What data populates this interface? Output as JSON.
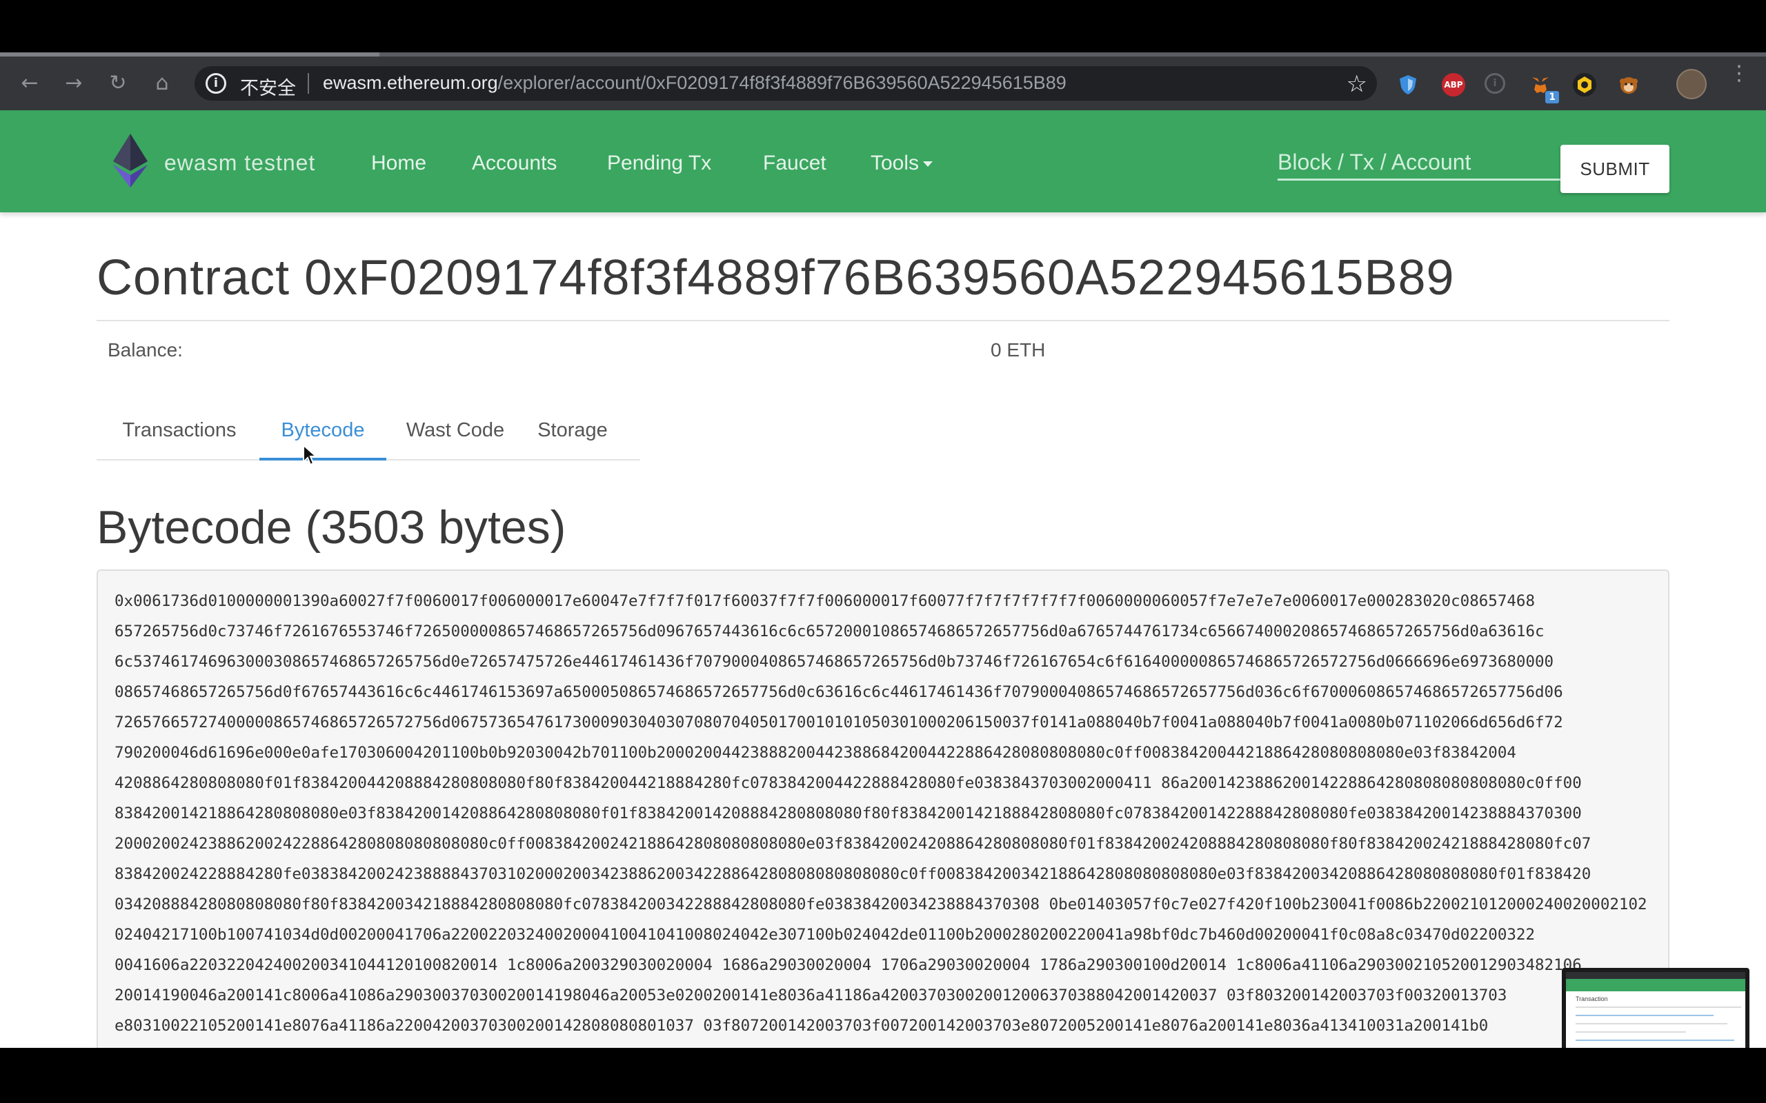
{
  "browser": {
    "nav": {
      "back": "←",
      "forward": "→",
      "reload": "↻",
      "home": "⌂"
    },
    "omnibox": {
      "security_label": "不安全",
      "url_host": "ewasm.ethereum.org",
      "url_path": "/explorer/account/0xF0209174f8f3f4889f76B639560A522945615B89"
    },
    "extensions": [
      {
        "icon": "shield-icon",
        "color": "#3c8ee0"
      },
      {
        "icon": "abp-icon",
        "label": "ABP",
        "color": "#c8272f"
      },
      {
        "icon": "info-circle-icon",
        "color": "#5f6368"
      },
      {
        "icon": "metamask-fox-icon",
        "badge": "1",
        "color": "#e2761b"
      },
      {
        "icon": "hexagon-icon",
        "color": "#202124"
      },
      {
        "icon": "monkey-icon",
        "color": "#b5651d"
      }
    ]
  },
  "site": {
    "brand": "ewasm testnet",
    "nav": [
      "Home",
      "Accounts",
      "Pending Tx",
      "Faucet",
      "Tools"
    ],
    "search_placeholder": "Block / Tx / Account",
    "submit_label": "SUBMIT",
    "accent": "#3aa660"
  },
  "contract": {
    "title": "Contract 0xF0209174f8f3f4889f76B639560A522945615B89",
    "balance_label": "Balance:",
    "balance_value": "0 ETH"
  },
  "tabs": [
    "Transactions",
    "Bytecode",
    "Wast Code",
    "Storage"
  ],
  "active_tab": "Bytecode",
  "bytecode": {
    "heading": "Bytecode (3503 bytes)",
    "lines": [
      "0x0061736d0100000001390a60027f7f0060017f006000017e60047e7f7f7f017f60037f7f7f006000017f60077f7f7f7f7f7f7f0060000060057f7e7e7e7e0060017e000283020c08657468",
      "657265756d0c73746f7261676553746f7265000008657468657265756d0967657443616c6c65720001086574686572657756d0a6765744761734c656674000208657468657265756d0a63616c",
      "6c537461746963000308657468657265756d0e72657475726e44617461436f7079000408657468657265756d0b73746f726167654c6f616400000865746865726572756d0666696e6973680000",
      "08657468657265756d0f67657443616c6c4461746153697a650005086574686572657756d0c63616c6c44617461436f70790004086574686572657756d036c6f670006086574686572657756d06",
      "72657665727400000865746865726572756d06757365476173000903040307080704050170010101050301000206150037f0141a088040b7f0041a088040b7f0041a0080b071102066d656d6f72",
      "790200046d61696e000e0afe170306004201100b0b92030042b701100b200020044238882004423886842004422886428080808080c0ff0083842004421886428080808080e03f83842004",
      "4208864280808080f01f838420044208884280808080f80f838420044218884280fc0783842004422888428080fe0383843703002000411 86a200142388620014228864280808080808080c0ff00",
      "838420014218864280808080e03f838420014208864280808080f01f838420014208884280808080f80f8384200142188842808080fc078384200142288842808080fe03838420014238884370300",
      "2000200242388620024228864280808080808080c0ff008384200242188642808080808080e03f838420024208864280808080f01f838420024208884280808080f80f83842002421888428080fc07",
      "838420024228884280fe0383842002423888843703102000200342388620034228864280808080808080c0ff008384200342188642808080808080e03f83842003420886428080808080f01f838420",
      "03420888428080808080f80f838420034218884280808080fc078384200342288842808080fe03838420034238884370308 0be01403057f0c7e027f420f100b230041f0086b220021012000240020002102",
      "02404217100b100741034d0d00200041706a2200220324002000410041041008024042e307100b024042de01100b2000280200220041a98bf0dc7b460d00200041f0c08a8c03470d02200322",
      "0041606a220322042400200341044120100820014 1c8006a200329030020004 1686a29030020004 1706a29030020004 1786a290300100d20014 1c8006a41106a290300210520012903482106",
      "20014190046a200141c8006a41086a29030037030020014198046a20053e0200200141e8036a41186a420037030020012006370388042001420037 03f803200142003703f00320013703",
      "e80310022105200141e8076a41186a22004200370300200142808080801037 03f807200142003703f007200142003703e8072005200141e8076a200141e8036a413410031a200141b0"
    ]
  },
  "thumbnail": {
    "title": "Transaction"
  }
}
